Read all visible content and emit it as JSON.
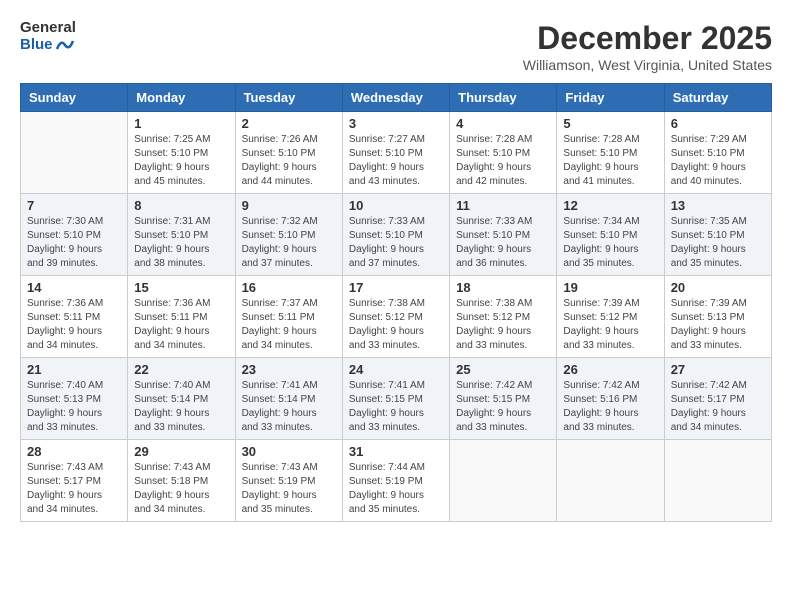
{
  "logo": {
    "general": "General",
    "blue": "Blue"
  },
  "title": "December 2025",
  "location": "Williamson, West Virginia, United States",
  "days_of_week": [
    "Sunday",
    "Monday",
    "Tuesday",
    "Wednesday",
    "Thursday",
    "Friday",
    "Saturday"
  ],
  "weeks": [
    [
      {
        "day": "",
        "sunrise": "",
        "sunset": "",
        "daylight": ""
      },
      {
        "day": "1",
        "sunrise": "Sunrise: 7:25 AM",
        "sunset": "Sunset: 5:10 PM",
        "daylight": "Daylight: 9 hours and 45 minutes."
      },
      {
        "day": "2",
        "sunrise": "Sunrise: 7:26 AM",
        "sunset": "Sunset: 5:10 PM",
        "daylight": "Daylight: 9 hours and 44 minutes."
      },
      {
        "day": "3",
        "sunrise": "Sunrise: 7:27 AM",
        "sunset": "Sunset: 5:10 PM",
        "daylight": "Daylight: 9 hours and 43 minutes."
      },
      {
        "day": "4",
        "sunrise": "Sunrise: 7:28 AM",
        "sunset": "Sunset: 5:10 PM",
        "daylight": "Daylight: 9 hours and 42 minutes."
      },
      {
        "day": "5",
        "sunrise": "Sunrise: 7:28 AM",
        "sunset": "Sunset: 5:10 PM",
        "daylight": "Daylight: 9 hours and 41 minutes."
      },
      {
        "day": "6",
        "sunrise": "Sunrise: 7:29 AM",
        "sunset": "Sunset: 5:10 PM",
        "daylight": "Daylight: 9 hours and 40 minutes."
      }
    ],
    [
      {
        "day": "7",
        "sunrise": "Sunrise: 7:30 AM",
        "sunset": "Sunset: 5:10 PM",
        "daylight": "Daylight: 9 hours and 39 minutes."
      },
      {
        "day": "8",
        "sunrise": "Sunrise: 7:31 AM",
        "sunset": "Sunset: 5:10 PM",
        "daylight": "Daylight: 9 hours and 38 minutes."
      },
      {
        "day": "9",
        "sunrise": "Sunrise: 7:32 AM",
        "sunset": "Sunset: 5:10 PM",
        "daylight": "Daylight: 9 hours and 37 minutes."
      },
      {
        "day": "10",
        "sunrise": "Sunrise: 7:33 AM",
        "sunset": "Sunset: 5:10 PM",
        "daylight": "Daylight: 9 hours and 37 minutes."
      },
      {
        "day": "11",
        "sunrise": "Sunrise: 7:33 AM",
        "sunset": "Sunset: 5:10 PM",
        "daylight": "Daylight: 9 hours and 36 minutes."
      },
      {
        "day": "12",
        "sunrise": "Sunrise: 7:34 AM",
        "sunset": "Sunset: 5:10 PM",
        "daylight": "Daylight: 9 hours and 35 minutes."
      },
      {
        "day": "13",
        "sunrise": "Sunrise: 7:35 AM",
        "sunset": "Sunset: 5:10 PM",
        "daylight": "Daylight: 9 hours and 35 minutes."
      }
    ],
    [
      {
        "day": "14",
        "sunrise": "Sunrise: 7:36 AM",
        "sunset": "Sunset: 5:11 PM",
        "daylight": "Daylight: 9 hours and 34 minutes."
      },
      {
        "day": "15",
        "sunrise": "Sunrise: 7:36 AM",
        "sunset": "Sunset: 5:11 PM",
        "daylight": "Daylight: 9 hours and 34 minutes."
      },
      {
        "day": "16",
        "sunrise": "Sunrise: 7:37 AM",
        "sunset": "Sunset: 5:11 PM",
        "daylight": "Daylight: 9 hours and 34 minutes."
      },
      {
        "day": "17",
        "sunrise": "Sunrise: 7:38 AM",
        "sunset": "Sunset: 5:12 PM",
        "daylight": "Daylight: 9 hours and 33 minutes."
      },
      {
        "day": "18",
        "sunrise": "Sunrise: 7:38 AM",
        "sunset": "Sunset: 5:12 PM",
        "daylight": "Daylight: 9 hours and 33 minutes."
      },
      {
        "day": "19",
        "sunrise": "Sunrise: 7:39 AM",
        "sunset": "Sunset: 5:12 PM",
        "daylight": "Daylight: 9 hours and 33 minutes."
      },
      {
        "day": "20",
        "sunrise": "Sunrise: 7:39 AM",
        "sunset": "Sunset: 5:13 PM",
        "daylight": "Daylight: 9 hours and 33 minutes."
      }
    ],
    [
      {
        "day": "21",
        "sunrise": "Sunrise: 7:40 AM",
        "sunset": "Sunset: 5:13 PM",
        "daylight": "Daylight: 9 hours and 33 minutes."
      },
      {
        "day": "22",
        "sunrise": "Sunrise: 7:40 AM",
        "sunset": "Sunset: 5:14 PM",
        "daylight": "Daylight: 9 hours and 33 minutes."
      },
      {
        "day": "23",
        "sunrise": "Sunrise: 7:41 AM",
        "sunset": "Sunset: 5:14 PM",
        "daylight": "Daylight: 9 hours and 33 minutes."
      },
      {
        "day": "24",
        "sunrise": "Sunrise: 7:41 AM",
        "sunset": "Sunset: 5:15 PM",
        "daylight": "Daylight: 9 hours and 33 minutes."
      },
      {
        "day": "25",
        "sunrise": "Sunrise: 7:42 AM",
        "sunset": "Sunset: 5:15 PM",
        "daylight": "Daylight: 9 hours and 33 minutes."
      },
      {
        "day": "26",
        "sunrise": "Sunrise: 7:42 AM",
        "sunset": "Sunset: 5:16 PM",
        "daylight": "Daylight: 9 hours and 33 minutes."
      },
      {
        "day": "27",
        "sunrise": "Sunrise: 7:42 AM",
        "sunset": "Sunset: 5:17 PM",
        "daylight": "Daylight: 9 hours and 34 minutes."
      }
    ],
    [
      {
        "day": "28",
        "sunrise": "Sunrise: 7:43 AM",
        "sunset": "Sunset: 5:17 PM",
        "daylight": "Daylight: 9 hours and 34 minutes."
      },
      {
        "day": "29",
        "sunrise": "Sunrise: 7:43 AM",
        "sunset": "Sunset: 5:18 PM",
        "daylight": "Daylight: 9 hours and 34 minutes."
      },
      {
        "day": "30",
        "sunrise": "Sunrise: 7:43 AM",
        "sunset": "Sunset: 5:19 PM",
        "daylight": "Daylight: 9 hours and 35 minutes."
      },
      {
        "day": "31",
        "sunrise": "Sunrise: 7:44 AM",
        "sunset": "Sunset: 5:19 PM",
        "daylight": "Daylight: 9 hours and 35 minutes."
      },
      {
        "day": "",
        "sunrise": "",
        "sunset": "",
        "daylight": ""
      },
      {
        "day": "",
        "sunrise": "",
        "sunset": "",
        "daylight": ""
      },
      {
        "day": "",
        "sunrise": "",
        "sunset": "",
        "daylight": ""
      }
    ]
  ]
}
